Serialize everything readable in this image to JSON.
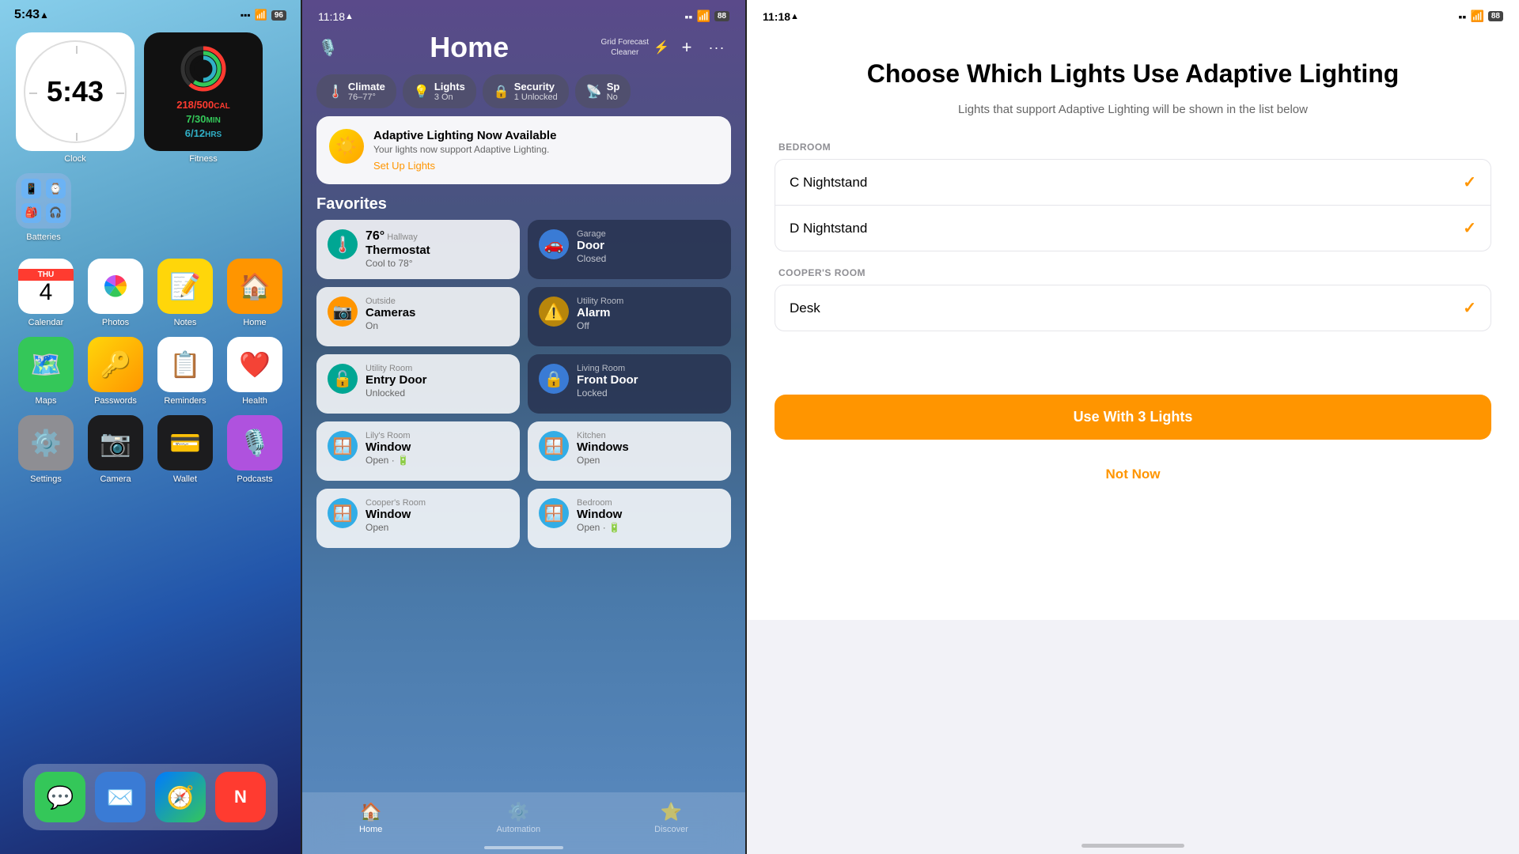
{
  "screen1": {
    "statusBar": {
      "time": "5:43",
      "locationIcon": "▲",
      "signal": "▪▪▪",
      "wifi": "WiFi",
      "battery": "96"
    },
    "widgets": {
      "clock": {
        "time": "5:43",
        "label": "Clock"
      },
      "fitness": {
        "calories": "218/500",
        "calUnit": "CAL",
        "minutes": "7/30",
        "minUnit": "MIN",
        "hours": "6/12",
        "hrUnit": "HRS",
        "label": "Fitness"
      }
    },
    "apps": [
      {
        "id": "calendar",
        "icon": "📅",
        "label": "Calendar",
        "bg": "#fff",
        "day": "4",
        "dayName": "THU"
      },
      {
        "id": "photos",
        "icon": "🌸",
        "label": "Photos",
        "bg": "#fff"
      },
      {
        "id": "notes",
        "icon": "📝",
        "label": "Notes",
        "bg": "#FFD60A"
      },
      {
        "id": "home",
        "icon": "🏠",
        "label": "Home",
        "bg": "#FF9500"
      },
      {
        "id": "maps",
        "icon": "🗺️",
        "label": "Maps",
        "bg": "#34C759"
      },
      {
        "id": "passwords",
        "icon": "🔑",
        "label": "Passwords",
        "bg": "#FFD60A"
      },
      {
        "id": "reminders",
        "icon": "📋",
        "label": "Reminders",
        "bg": "#fff"
      },
      {
        "id": "health",
        "icon": "❤️",
        "label": "Health",
        "bg": "#fff"
      },
      {
        "id": "settings",
        "icon": "⚙️",
        "label": "Settings",
        "bg": "#8E8E93"
      },
      {
        "id": "camera",
        "icon": "📷",
        "label": "Camera",
        "bg": "#000"
      },
      {
        "id": "wallet",
        "icon": "💳",
        "label": "Wallet",
        "bg": "#000"
      },
      {
        "id": "podcasts",
        "icon": "🎙️",
        "label": "Podcasts",
        "bg": "#AF52DE"
      }
    ],
    "dock": [
      {
        "id": "messages",
        "icon": "💬",
        "bg": "#34C759"
      },
      {
        "id": "mail",
        "icon": "✉️",
        "bg": "#3A7BD5"
      },
      {
        "id": "safari",
        "icon": "🧭",
        "bg": "#3A7BD5"
      },
      {
        "id": "news",
        "icon": "N",
        "bg": "#FF3B30"
      }
    ]
  },
  "screen2": {
    "statusBar": {
      "time": "11:18",
      "locationIcon": "▲",
      "signal": "▪▪",
      "wifi": "WiFi",
      "battery": "88"
    },
    "header": {
      "title": "Home",
      "gridForecastLabel": "Grid Forecast",
      "gridForecastSub": "Cleaner",
      "addBtn": "+",
      "moreBtn": "···"
    },
    "pills": [
      {
        "icon": "🌡️",
        "main": "Climate",
        "sub": "76–77°"
      },
      {
        "icon": "💡",
        "main": "Lights",
        "sub": "3 On"
      },
      {
        "icon": "🔒",
        "main": "Security",
        "sub": "1 Unlocked"
      },
      {
        "icon": "📡",
        "main": "Sp",
        "sub": "No"
      }
    ],
    "adaptiveCard": {
      "icon": "☀️",
      "title": "Adaptive Lighting Now Available",
      "subtitle": "Your lights now support Adaptive Lighting.",
      "setupLabel": "Set Up Lights"
    },
    "favoritesLabel": "Favorites",
    "favorites": [
      {
        "room": "Hallway",
        "device": "Thermostat",
        "status": "Cool to 78°",
        "extra": "76°",
        "iconBg": "icon-teal",
        "icon": "🌡️",
        "style": "light"
      },
      {
        "room": "Garage",
        "device": "Door",
        "status": "Closed",
        "iconBg": "icon-blue",
        "icon": "🚗",
        "style": "dark"
      },
      {
        "room": "Outside",
        "device": "Cameras",
        "status": "On",
        "iconBg": "icon-orange",
        "icon": "📷",
        "style": "light"
      },
      {
        "room": "Utility Room",
        "device": "Alarm",
        "status": "Off",
        "iconBg": "icon-yellow",
        "icon": "⚠️",
        "style": "dark"
      },
      {
        "room": "Utility Room",
        "device": "Entry Door",
        "status": "Unlocked",
        "iconBg": "icon-teal",
        "icon": "🚪",
        "style": "light"
      },
      {
        "room": "Living Room",
        "device": "Front Door",
        "status": "Locked",
        "iconBg": "icon-blue",
        "icon": "🔒",
        "style": "dark"
      },
      {
        "room": "Lily's Room",
        "device": "Window",
        "status": "Open · 🔋",
        "iconBg": "icon-cyan",
        "icon": "🪟",
        "style": "light"
      },
      {
        "room": "Kitchen",
        "device": "Windows",
        "status": "Open",
        "iconBg": "icon-cyan",
        "icon": "🪟",
        "style": "light"
      },
      {
        "room": "Cooper's Room",
        "device": "Window",
        "status": "Open",
        "iconBg": "icon-cyan",
        "icon": "🪟",
        "style": "light"
      },
      {
        "room": "Bedroom",
        "device": "Window",
        "status": "Open · 🔋",
        "iconBg": "icon-cyan",
        "icon": "🪟",
        "style": "light"
      }
    ],
    "bottomNav": [
      {
        "id": "home",
        "icon": "🏠",
        "label": "Home",
        "active": true
      },
      {
        "id": "automation",
        "icon": "⚙️",
        "label": "Automation",
        "active": false
      },
      {
        "id": "discover",
        "icon": "⭐",
        "label": "Discover",
        "active": false
      }
    ]
  },
  "screen3": {
    "statusBar": {
      "time": "11:18",
      "locationIcon": "▲",
      "signal": "▪▪",
      "wifi": "WiFi",
      "battery": "88"
    },
    "title": "Choose Which Lights Use Adaptive Lighting",
    "subtitle": "Lights that support Adaptive Lighting will be shown in the list below",
    "sections": [
      {
        "header": "BEDROOM",
        "items": [
          {
            "name": "C Nightstand",
            "checked": true
          },
          {
            "name": "D Nightstand",
            "checked": true
          }
        ]
      },
      {
        "header": "COOPER'S ROOM",
        "items": [
          {
            "name": "Desk",
            "checked": true
          }
        ]
      }
    ],
    "primaryBtn": "Use With 3 Lights",
    "secondaryBtn": "Not Now"
  }
}
